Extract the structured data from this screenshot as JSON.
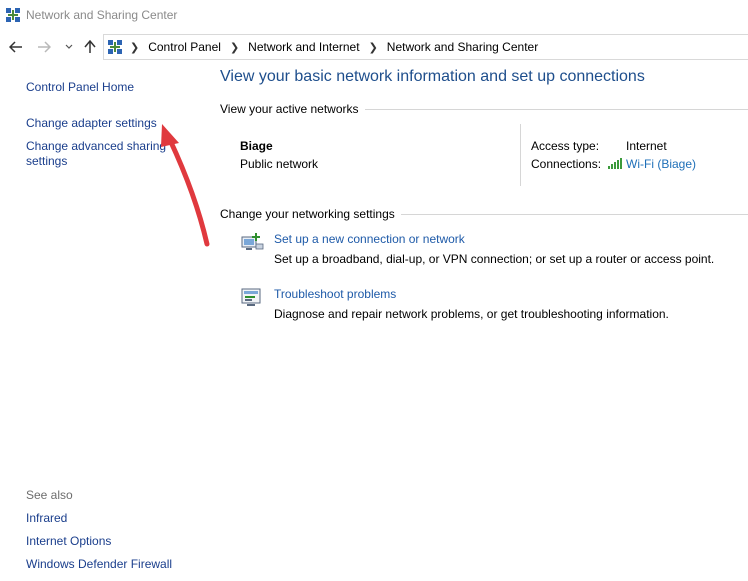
{
  "window": {
    "title": "Network and Sharing Center"
  },
  "navigation": {
    "back_icon": "back-arrow-icon",
    "forward_icon": "forward-arrow-icon",
    "recent_icon": "chevron-down-icon",
    "up_icon": "up-arrow-icon",
    "breadcrumb": [
      "Control Panel",
      "Network and Internet",
      "Network and Sharing Center"
    ]
  },
  "sidebar": {
    "items": [
      {
        "label": "Control Panel Home"
      },
      {
        "label": "Change adapter settings"
      },
      {
        "label": "Change advanced sharing settings"
      }
    ],
    "see_also_label": "See also",
    "see_also": [
      {
        "label": "Infrared"
      },
      {
        "label": "Internet Options"
      },
      {
        "label": "Windows Defender Firewall"
      }
    ]
  },
  "main": {
    "heading": "View your basic network information and set up connections",
    "active_networks_label": "View your active networks",
    "network": {
      "name": "Biage",
      "type": "Public network",
      "access_type_label": "Access type:",
      "access_type_value": "Internet",
      "connections_label": "Connections:",
      "connection_link": "Wi-Fi (Biage)"
    },
    "change_settings_label": "Change your networking settings",
    "tasks": [
      {
        "icon": "network-setup-icon",
        "link": "Set up a new connection or network",
        "description": "Set up a broadband, dial-up, or VPN connection; or set up a router or access point."
      },
      {
        "icon": "troubleshoot-icon",
        "link": "Troubleshoot problems",
        "description": "Diagnose and repair network problems, or get troubleshooting information."
      }
    ]
  },
  "colors": {
    "link": "#1a3e8c",
    "heading": "#1e4e8c",
    "annotation_arrow": "#e0393e"
  }
}
